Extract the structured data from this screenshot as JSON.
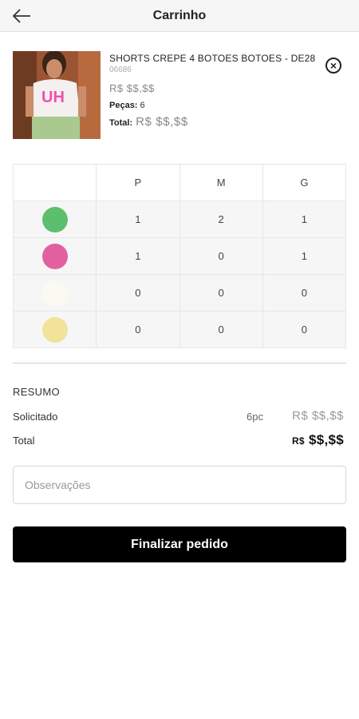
{
  "header": {
    "title": "Carrinho",
    "back_icon": "arrow-left-icon"
  },
  "product": {
    "name": "SHORTS CREPE 4 BOTOES BOTOES - DE28",
    "code": "06686",
    "price": "R$ $$,$$",
    "pieces_label": "Peças:",
    "pieces_value": "6",
    "total_label": "Total:",
    "total_value": "R$ $$,$$",
    "remove_icon": "close-circle-icon"
  },
  "grid": {
    "sizes": [
      "P",
      "M",
      "G"
    ],
    "rows": [
      {
        "color": "#5cbf6e",
        "values": [
          "1",
          "2",
          "1"
        ]
      },
      {
        "color": "#e2609f",
        "values": [
          "1",
          "0",
          "1"
        ]
      },
      {
        "color": "#fafaf0",
        "values": [
          "0",
          "0",
          "0"
        ]
      },
      {
        "color": "#f2e39a",
        "values": [
          "0",
          "0",
          "0"
        ]
      }
    ]
  },
  "summary": {
    "title": "RESUMO",
    "requested_label": "Solicitado",
    "requested_count": "6pc",
    "requested_value": "R$ $$,$$",
    "total_label": "Total",
    "total_currency": "R$",
    "total_value": "$$,$$"
  },
  "notes": {
    "placeholder": "Observações"
  },
  "actions": {
    "finish_label": "Finalizar pedido"
  }
}
